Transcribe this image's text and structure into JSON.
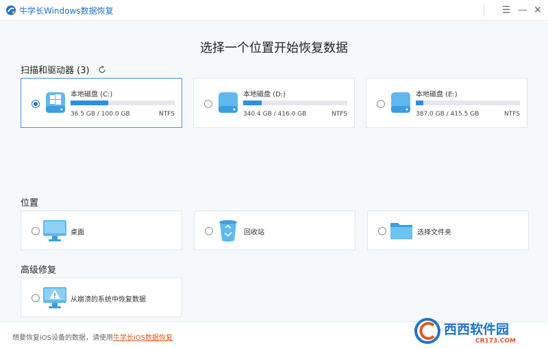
{
  "window": {
    "title": "牛学长Windows数据恢复",
    "menu_glyph": "☰",
    "min_glyph": "—",
    "close_glyph": "✕"
  },
  "page_title": "选择一个位置开始恢复数据",
  "drives_section": {
    "label": "扫描和驱动器 (3)",
    "drives": [
      {
        "name": "本地磁盘 (C:)",
        "size": "36.5 GB / 100.0 GB",
        "fs": "NTFS",
        "used_fraction": 0.365,
        "selected": true
      },
      {
        "name": "本地磁盘 (D:)",
        "size": "340.4 GB / 416.0 GB",
        "fs": "NTFS",
        "used_fraction": 0.18,
        "selected": false
      },
      {
        "name": "本地磁盘 (E:)",
        "size": "387.0 GB / 415.5 GB",
        "fs": "NTFS",
        "used_fraction": 0.07,
        "selected": false
      }
    ]
  },
  "location_section": {
    "label": "位置",
    "items": [
      {
        "label": "桌面",
        "icon": "desktop-icon"
      },
      {
        "label": "回收站",
        "icon": "recycle-bin-icon"
      },
      {
        "label": "选择文件夹",
        "icon": "folder-icon"
      }
    ]
  },
  "advanced_section": {
    "label": "高级修复",
    "items": [
      {
        "label": "从崩溃的系统中恢复数据",
        "icon": "crashed-system-icon"
      }
    ]
  },
  "footer": {
    "text": "想要恢复iOS设备的数据，请使用",
    "link": "牛学长iOS数据恢复"
  },
  "watermark": {
    "text": "西西软件园",
    "sub": "CR173.COM"
  },
  "colors": {
    "accent": "#1e73c8",
    "bar": "#2f8ee0",
    "link": "#e2571e",
    "selected_border": "#4a8de0"
  }
}
